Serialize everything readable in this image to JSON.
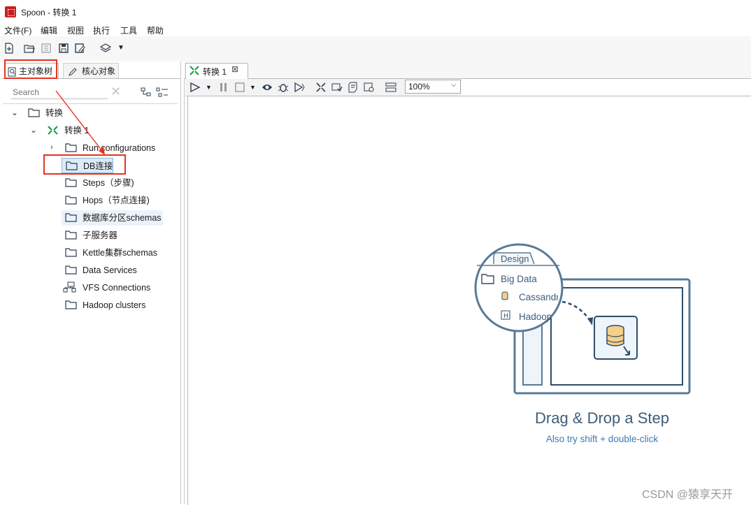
{
  "window": {
    "title": "Spoon - 转换 1"
  },
  "menu": [
    "文件(F)",
    "编辑",
    "视图",
    "执行",
    "工具",
    "帮助"
  ],
  "left_panel": {
    "tabs": {
      "main": "主对象树",
      "core": "核心对象"
    },
    "search_placeholder": "Search",
    "tree": {
      "root": "转换",
      "transformation": "转换 1",
      "children": [
        "Run configurations",
        "DB连接",
        "Steps（步骤)",
        "Hops（节点连接)",
        "数据库分区schemas",
        "子服务器",
        "Kettle集群schemas",
        "Data Services",
        "VFS Connections",
        "Hadoop clusters"
      ]
    }
  },
  "editor": {
    "tab_label": "转换 1",
    "zoom": "100%"
  },
  "illustration": {
    "design_tab": "Design",
    "folder": "Big Data",
    "item1": "Cassandr",
    "item2": "Hadoop",
    "title": "Drag & Drop a Step",
    "subtitle": "Also try shift + double-click"
  },
  "watermark": "CSDN @猿享天开",
  "colors": {
    "annotation": "#e8321f",
    "selection": "#dcebf8",
    "illustration": "#3d5d7a"
  }
}
